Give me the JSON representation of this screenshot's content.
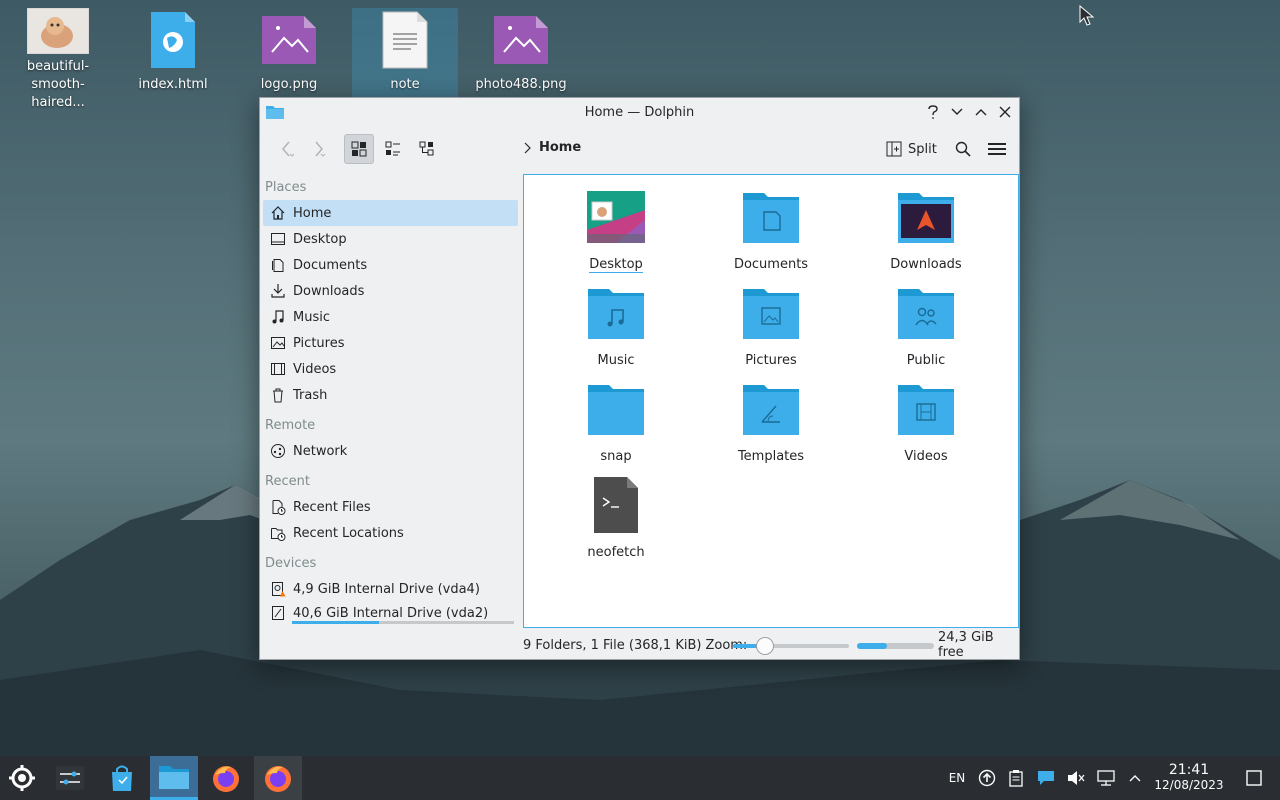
{
  "desktop": {
    "icons": [
      {
        "label": "beautiful-smooth-haired..."
      },
      {
        "label": "index.html"
      },
      {
        "label": "logo.png"
      },
      {
        "label": "note"
      },
      {
        "label": "photo488.png"
      }
    ]
  },
  "window": {
    "title": "Home — Dolphin",
    "breadcrumb": "Home",
    "split_label": "Split"
  },
  "sidebar": {
    "places_header": "Places",
    "places": [
      "Home",
      "Desktop",
      "Documents",
      "Downloads",
      "Music",
      "Pictures",
      "Videos",
      "Trash"
    ],
    "remote_header": "Remote",
    "remote": [
      "Network"
    ],
    "recent_header": "Recent",
    "recent": [
      "Recent Files",
      "Recent Locations"
    ],
    "devices_header": "Devices",
    "devices": [
      {
        "label": "4,9 GiB Internal Drive (vda4)"
      },
      {
        "label": "40,6 GiB Internal Drive (vda2)",
        "usage_fraction": 0.39
      }
    ]
  },
  "files": [
    {
      "name": "Desktop",
      "icon": "desktop-folder-icon"
    },
    {
      "name": "Documents",
      "icon": "documents-folder-icon"
    },
    {
      "name": "Downloads",
      "icon": "downloads-folder-icon"
    },
    {
      "name": "Music",
      "icon": "music-folder-icon"
    },
    {
      "name": "Pictures",
      "icon": "pictures-folder-icon"
    },
    {
      "name": "Public",
      "icon": "public-folder-icon"
    },
    {
      "name": "snap",
      "icon": "folder-icon"
    },
    {
      "name": "Templates",
      "icon": "templates-folder-icon"
    },
    {
      "name": "Videos",
      "icon": "videos-folder-icon"
    },
    {
      "name": "neofetch",
      "icon": "script-file-icon"
    }
  ],
  "status": {
    "summary": "9 Folders, 1 File (368,1 KiB)",
    "zoom_label": "Zoom:",
    "zoom_fraction": 0.28,
    "free_space": "24,3 GiB free",
    "used_fraction": 0.39
  },
  "tray": {
    "lang": "EN",
    "time": "21:41",
    "date": "12/08/2023"
  },
  "colors": {
    "accent": "#3daee9",
    "folder": "#3daee9",
    "taskbar": "#2a2e32"
  }
}
